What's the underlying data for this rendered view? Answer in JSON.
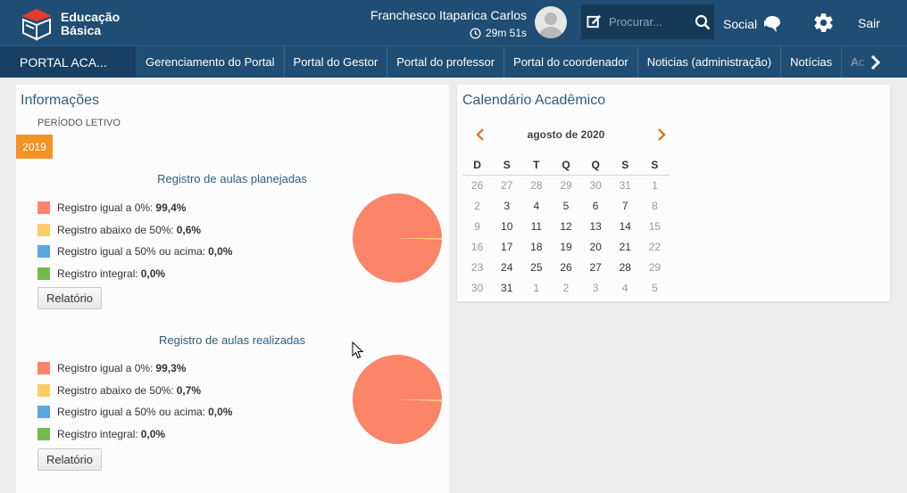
{
  "header": {
    "logo_line1": "Educação",
    "logo_line2": "Básica",
    "user_name": "Franchesco Itaparica Carlos",
    "session_timer": "29m 51s",
    "search_placeholder": "Procurar...",
    "social_label": "Social",
    "logout_label": "Sair"
  },
  "nav": {
    "first": "PORTAL ACA...",
    "items": [
      "Gerenciamento do Portal",
      "Portal do Gestor",
      "Portal do professor",
      "Portal do coordenador",
      "Noticias (administração)",
      "Notícias",
      "Ac"
    ]
  },
  "info": {
    "title": "Informações",
    "period_label": "PERÍODO LETIVO",
    "period_value": "2019",
    "planned": {
      "title": "Registro de aulas planejadas",
      "items": [
        {
          "label": "Registro igual a 0%:",
          "value": "99,4%",
          "color": "#fb8469",
          "pct": 99.4
        },
        {
          "label": "Registro abaixo de 50%:",
          "value": "0,6%",
          "color": "#fdcb6a",
          "pct": 0.6
        },
        {
          "label": "Registro igual a 50% ou acima:",
          "value": "0,0%",
          "color": "#5aa6dd",
          "pct": 0.0
        },
        {
          "label": "Registro integral:",
          "value": "0,0%",
          "color": "#71bb4a",
          "pct": 0.0
        }
      ],
      "button": "Relatório"
    },
    "done": {
      "title": "Registro de aulas realizadas",
      "items": [
        {
          "label": "Registro igual a 0%:",
          "value": "99,3%",
          "color": "#fb8469",
          "pct": 99.3
        },
        {
          "label": "Registro abaixo de 50%:",
          "value": "0,7%",
          "color": "#fdcb6a",
          "pct": 0.7
        },
        {
          "label": "Registro igual a 50% ou acima:",
          "value": "0,0%",
          "color": "#5aa6dd",
          "pct": 0.0
        },
        {
          "label": "Registro integral:",
          "value": "0,0%",
          "color": "#71bb4a",
          "pct": 0.0
        }
      ],
      "button": "Relatório"
    }
  },
  "calendar": {
    "title": "Calendário Acadêmico",
    "month_label": "agosto de 2020",
    "weekdays": [
      "D",
      "S",
      "T",
      "Q",
      "Q",
      "S",
      "S"
    ],
    "weeks": [
      [
        "26",
        "27",
        "28",
        "29",
        "30",
        "31",
        "1"
      ],
      [
        "2",
        "3",
        "4",
        "5",
        "6",
        "7",
        "8"
      ],
      [
        "9",
        "10",
        "11",
        "12",
        "13",
        "14",
        "15"
      ],
      [
        "16",
        "17",
        "18",
        "19",
        "20",
        "21",
        "22"
      ],
      [
        "23",
        "24",
        "25",
        "26",
        "27",
        "28",
        "29"
      ],
      [
        "30",
        "31",
        "1",
        "2",
        "3",
        "4",
        "5"
      ]
    ],
    "muted": [
      [
        true,
        true,
        true,
        true,
        true,
        true,
        true
      ],
      [
        true,
        false,
        false,
        false,
        false,
        false,
        true
      ],
      [
        true,
        false,
        false,
        false,
        false,
        false,
        true
      ],
      [
        true,
        false,
        false,
        false,
        false,
        false,
        true
      ],
      [
        true,
        false,
        false,
        false,
        false,
        false,
        true
      ],
      [
        true,
        false,
        true,
        true,
        true,
        true,
        true
      ]
    ]
  }
}
